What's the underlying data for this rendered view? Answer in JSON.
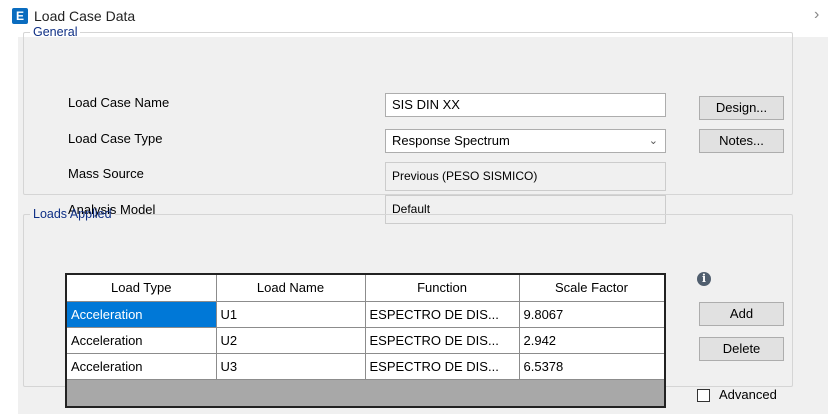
{
  "window": {
    "title": "Load Case Data",
    "app_icon_letter": "E",
    "close_glyph": "›"
  },
  "general": {
    "legend": "General",
    "load_case_name": {
      "label": "Load Case Name",
      "value": "SIS DIN XX"
    },
    "load_case_type": {
      "label": "Load Case Type",
      "value": "Response Spectrum"
    },
    "mass_source": {
      "label": "Mass Source",
      "value": "Previous  (PESO SISMICO)"
    },
    "analysis_model": {
      "label": "Analysis Model",
      "value": "Default"
    },
    "design_button": "Design...",
    "notes_button": "Notes..."
  },
  "loads_applied": {
    "legend": "Loads Applied",
    "columns": [
      "Load Type",
      "Load Name",
      "Function",
      "Scale Factor"
    ],
    "rows": [
      [
        "Acceleration",
        "U1",
        "ESPECTRO DE DIS...",
        "9.8067"
      ],
      [
        "Acceleration",
        "U2",
        "ESPECTRO DE DIS...",
        "2.942"
      ],
      [
        "Acceleration",
        "U3",
        "ESPECTRO DE DIS...",
        "6.5378"
      ]
    ],
    "add_button": "Add",
    "delete_button": "Delete",
    "advanced_label": "Advanced",
    "advanced_checked": false,
    "info_glyph": "i"
  },
  "colors": {
    "accent": "#0078d7",
    "legend_text": "#0e2f85",
    "app_icon": "#0a6cbf"
  }
}
